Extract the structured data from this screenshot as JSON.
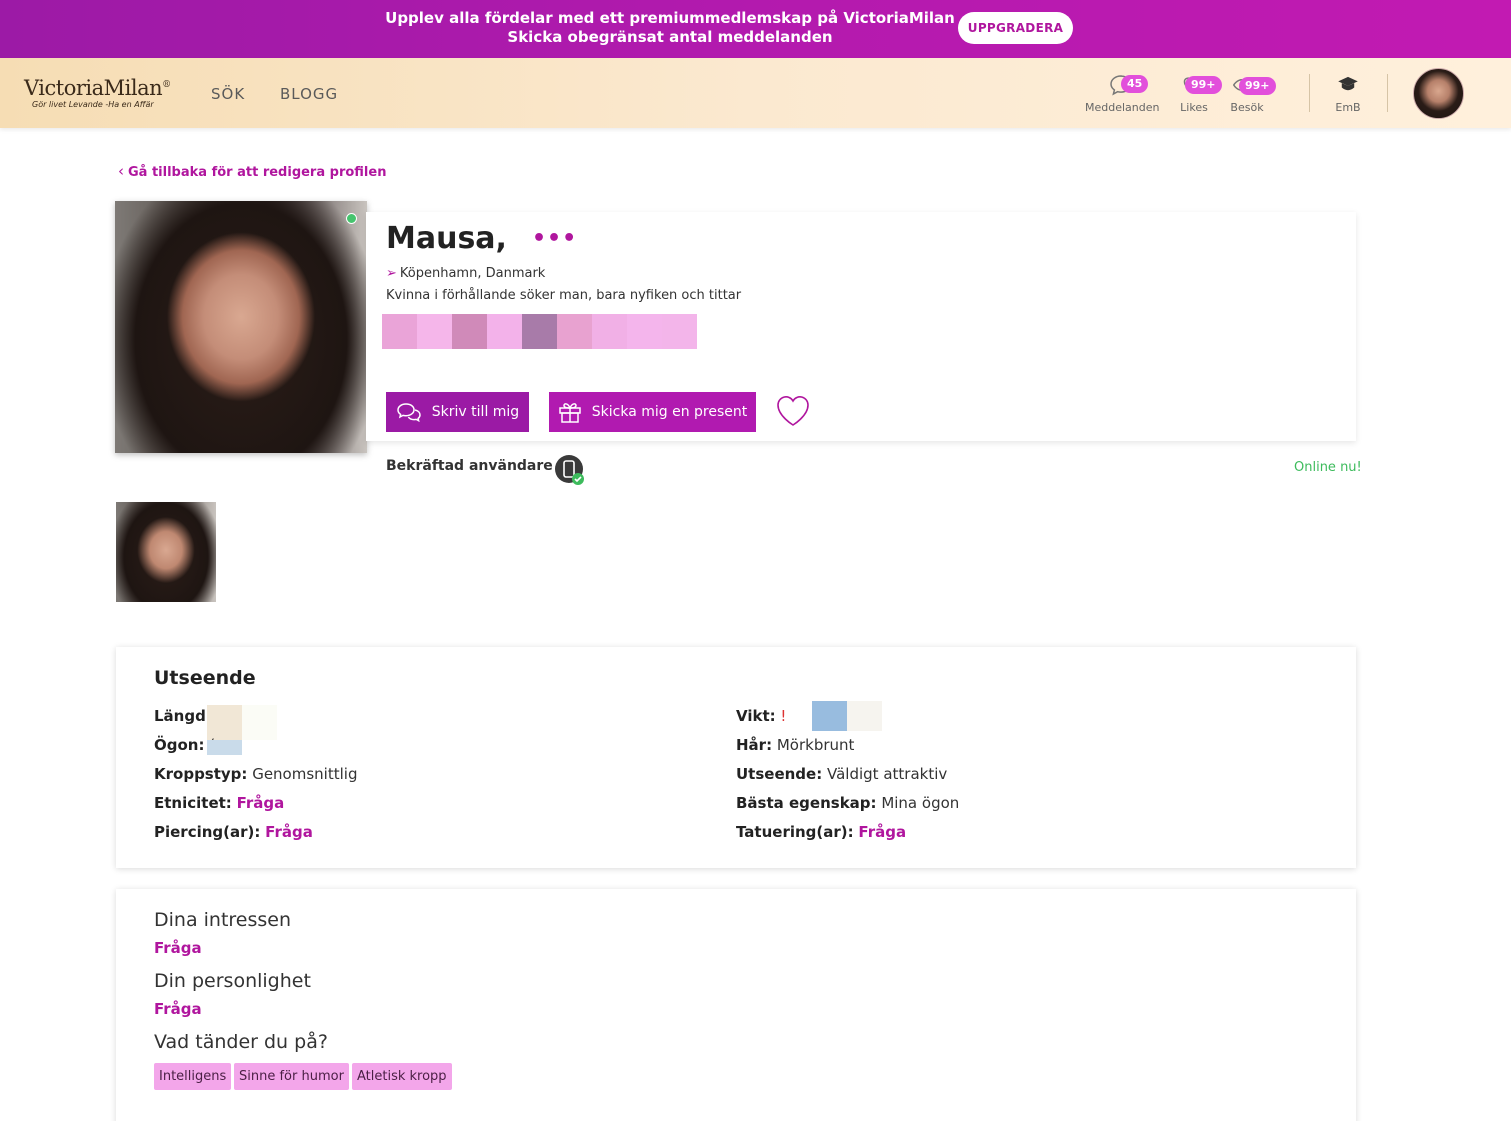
{
  "promo": {
    "line1": "Upplev alla fördelar med ett premiummedlemskap på VictoriaMilan",
    "line2": "Skicka obegränsat antal meddelanden",
    "button": "UPPGRADERA"
  },
  "header": {
    "logo": "VictoriaMilan",
    "logo_mark": "®",
    "tagline": "Gör livet Levande -Ha en Affär",
    "nav": [
      "SÖK",
      "BLOGG"
    ],
    "messages": {
      "count": "45",
      "label": "Meddelanden"
    },
    "likes": {
      "count": "99+",
      "label": "Likes"
    },
    "visits": {
      "count": "99+",
      "label": "Besök"
    },
    "emb": {
      "label": "EmB"
    }
  },
  "back_link": "Gå tillbaka för att redigera profilen",
  "profile": {
    "name": "Mausa,",
    "more": "•••",
    "location": "Köpenhamn, Danmark",
    "description": "Kvinna i förhållande söker man, bara nyfiken och tittar",
    "write_button": "Skriv till mig",
    "gift_button": "Skicka mig en present",
    "verified": "Bekräftad användare",
    "online": "Online nu!"
  },
  "colors": {
    "accent": "#b0169e",
    "promo_bg": "#b31aae",
    "online": "#3dbb5c",
    "tag_bg": "#f3a6ea"
  },
  "appearance": {
    "title": "Utseende",
    "left": [
      {
        "label": "Längd:",
        "value": ""
      },
      {
        "label": "Ögon:",
        "value": "("
      },
      {
        "label": "Kroppstyp:",
        "value": "Genomsnittlig"
      },
      {
        "label": "Etnicitet:",
        "value": "Fråga"
      },
      {
        "label": "Piercing(ar):",
        "value": "Fråga"
      }
    ],
    "right": [
      {
        "label": "Vikt:",
        "value": "!"
      },
      {
        "label": "Hår:",
        "value": "Mörkbrunt"
      },
      {
        "label": "Utseende:",
        "value": "Väldigt attraktiv"
      },
      {
        "label": "Bästa egenskap:",
        "value": "Mina ögon"
      },
      {
        "label": "Tatuering(ar):",
        "value": "Fråga"
      }
    ]
  },
  "interests": {
    "title1": "Dina intressen",
    "ask1": "Fråga",
    "title2": "Din personlighet",
    "ask2": "Fråga",
    "title3": "Vad tänder du på?",
    "tags": [
      "Intelligens",
      "Sinne för humor",
      "Atletisk kropp"
    ]
  }
}
